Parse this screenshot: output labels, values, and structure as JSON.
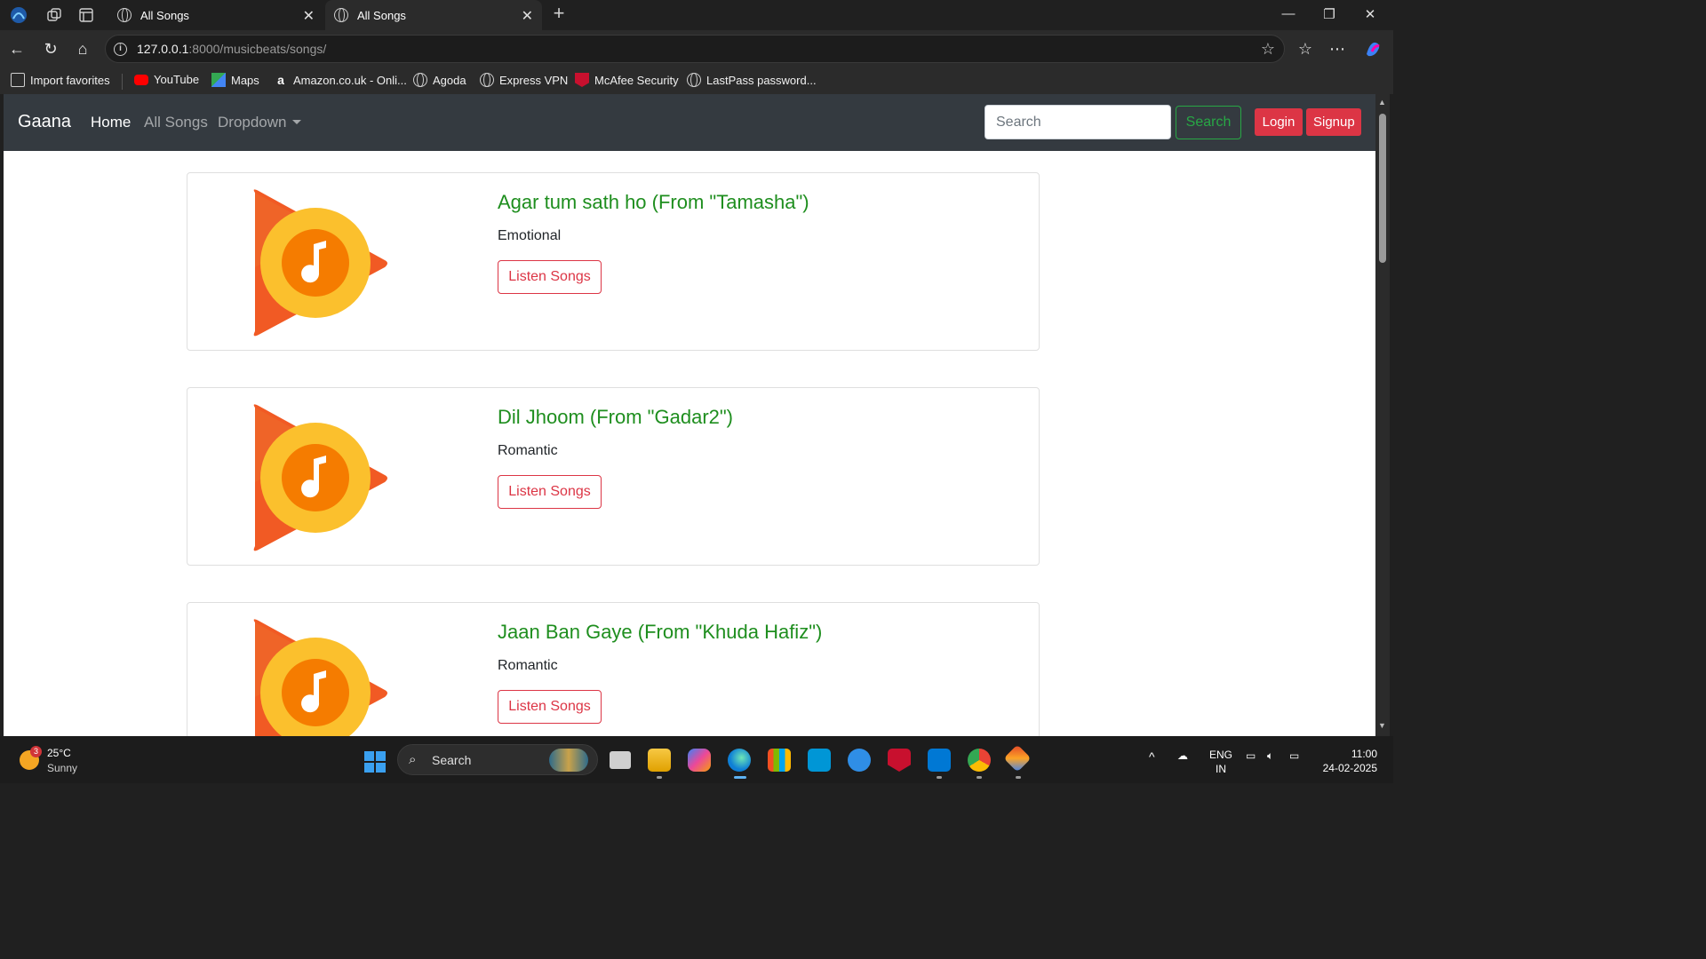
{
  "browser": {
    "tabs": [
      {
        "title": "All Songs"
      },
      {
        "title": "All Songs"
      }
    ],
    "url_host": "127.0.0.1",
    "url_rest": ":8000/musicbeats/songs/",
    "bookmarks": [
      {
        "label": "Import favorites"
      },
      {
        "label": "YouTube"
      },
      {
        "label": "Maps"
      },
      {
        "label": "Amazon.co.uk - Onli..."
      },
      {
        "label": "Agoda"
      },
      {
        "label": "Express VPN"
      },
      {
        "label": "McAfee Security"
      },
      {
        "label": "LastPass password..."
      }
    ]
  },
  "site": {
    "brand": "Gaana",
    "nav": {
      "home": "Home",
      "all_songs": "All Songs",
      "dropdown": "Dropdown"
    },
    "search_placeholder": "Search",
    "search_button": "Search",
    "login": "Login",
    "signup": "Signup"
  },
  "songs": [
    {
      "title": "Agar tum sath ho (From \"Tamasha\")",
      "category": "Emotional",
      "button": "Listen Songs"
    },
    {
      "title": "Dil Jhoom (From \"Gadar2\")",
      "category": "Romantic",
      "button": "Listen Songs"
    },
    {
      "title": "Jaan Ban Gaye (From \"Khuda Hafiz\")",
      "category": "Romantic",
      "button": "Listen Songs"
    }
  ],
  "taskbar": {
    "weather_temp": "25°C",
    "weather_cond": "Sunny",
    "weather_badge": "3",
    "search_label": "Search",
    "lang_top": "ENG",
    "lang_bottom": "IN",
    "time": "11:00",
    "date": "24-02-2025"
  }
}
